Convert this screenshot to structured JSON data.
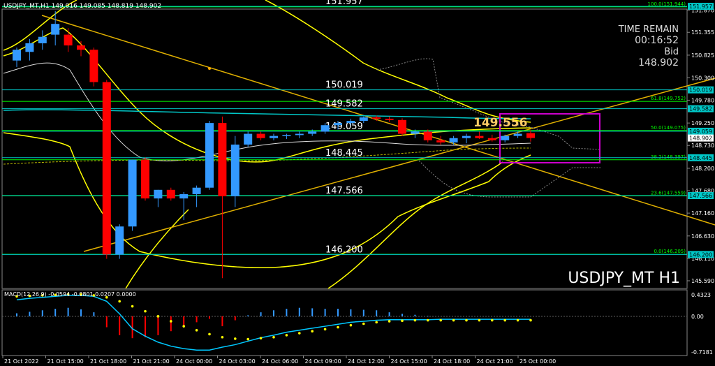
{
  "header": {
    "title": "USDJPY_MT,H1  149.016 149.085 148.819 148.902"
  },
  "info": {
    "time_remain_label": "TIME REMAIN",
    "time_remain": "00:16:52",
    "bid_label": "Bid",
    "bid": "148.902",
    "watermark": "USDJPY_MT H1",
    "current_price_label": "149.556"
  },
  "colors": {
    "background": "#000000",
    "bull": "#3399ff",
    "bear": "#ff0000",
    "fibo": "#00ff00",
    "hline": "#00c8c8",
    "band": "#ffff00",
    "rect": "#cc00cc",
    "macd_signal": "#00c8ff",
    "macd_dots": "#ffff00"
  },
  "chart_data": [
    {
      "type": "candlestick",
      "title": "USDJPY_MT,H1",
      "ylim": [
        145.59,
        151.78
      ],
      "y_ticks": [
        "151.870",
        "151.355",
        "150.825",
        "150.300",
        "149.780",
        "149.250",
        "148.730",
        "148.200",
        "147.680",
        "147.160",
        "146.630",
        "146.110",
        "145.590"
      ],
      "x_ticks": [
        "21 Oct 2022",
        "21 Oct 15:00",
        "21 Oct 18:00",
        "21 Oct 21:00",
        "24 Oct 00:00",
        "24 Oct 03:00",
        "24 Oct 06:00",
        "24 Oct 09:00",
        "24 Oct 12:00",
        "24 Oct 15:00",
        "24 Oct 18:00",
        "24 Oct 21:00",
        "25 Oct 00:00"
      ],
      "candles": [
        {
          "o": 150.7,
          "h": 151.0,
          "l": 150.55,
          "c": 150.95
        },
        {
          "o": 150.9,
          "h": 151.2,
          "l": 150.7,
          "c": 151.1
        },
        {
          "o": 151.1,
          "h": 151.4,
          "l": 150.95,
          "c": 151.25
        },
        {
          "o": 151.3,
          "h": 151.85,
          "l": 151.05,
          "c": 151.55
        },
        {
          "o": 151.3,
          "h": 151.45,
          "l": 150.9,
          "c": 151.05
        },
        {
          "o": 151.05,
          "h": 151.15,
          "l": 150.8,
          "c": 150.95
        },
        {
          "o": 150.95,
          "h": 151.0,
          "l": 150.1,
          "c": 150.2
        },
        {
          "o": 150.2,
          "h": 150.25,
          "l": 146.1,
          "c": 146.2
        },
        {
          "o": 146.2,
          "h": 146.9,
          "l": 146.1,
          "c": 146.85
        },
        {
          "o": 146.85,
          "h": 148.4,
          "l": 146.75,
          "c": 148.4
        },
        {
          "o": 148.4,
          "h": 148.45,
          "l": 147.45,
          "c": 147.5
        },
        {
          "o": 147.5,
          "h": 147.7,
          "l": 147.3,
          "c": 147.7
        },
        {
          "o": 147.7,
          "h": 147.75,
          "l": 147.45,
          "c": 147.5
        },
        {
          "o": 147.5,
          "h": 147.65,
          "l": 147.0,
          "c": 147.6
        },
        {
          "o": 147.6,
          "h": 147.8,
          "l": 147.3,
          "c": 147.75
        },
        {
          "o": 147.75,
          "h": 149.3,
          "l": 147.7,
          "c": 149.25
        },
        {
          "o": 149.25,
          "h": 149.4,
          "l": 145.65,
          "c": 147.55
        },
        {
          "o": 147.55,
          "h": 148.95,
          "l": 147.3,
          "c": 148.75
        },
        {
          "o": 148.75,
          "h": 149.05,
          "l": 148.7,
          "c": 149.0
        },
        {
          "o": 149.0,
          "h": 149.05,
          "l": 148.85,
          "c": 148.9
        },
        {
          "o": 148.9,
          "h": 149.0,
          "l": 148.85,
          "c": 148.95
        },
        {
          "o": 148.95,
          "h": 149.0,
          "l": 148.88,
          "c": 148.97
        },
        {
          "o": 148.97,
          "h": 149.05,
          "l": 148.9,
          "c": 149.0
        },
        {
          "o": 149.0,
          "h": 149.1,
          "l": 148.95,
          "c": 149.05
        },
        {
          "o": 149.05,
          "h": 149.25,
          "l": 149.0,
          "c": 149.2
        },
        {
          "o": 149.2,
          "h": 149.3,
          "l": 149.1,
          "c": 149.25
        },
        {
          "o": 149.25,
          "h": 149.35,
          "l": 149.2,
          "c": 149.3
        },
        {
          "o": 149.3,
          "h": 149.4,
          "l": 149.25,
          "c": 149.38
        },
        {
          "o": 149.38,
          "h": 149.42,
          "l": 149.3,
          "c": 149.35
        },
        {
          "o": 149.35,
          "h": 149.4,
          "l": 149.28,
          "c": 149.32
        },
        {
          "o": 149.32,
          "h": 149.36,
          "l": 148.95,
          "c": 149.0
        },
        {
          "o": 149.0,
          "h": 149.1,
          "l": 148.9,
          "c": 149.05
        },
        {
          "o": 149.05,
          "h": 149.1,
          "l": 148.8,
          "c": 148.85
        },
        {
          "o": 148.85,
          "h": 148.95,
          "l": 148.75,
          "c": 148.8
        },
        {
          "o": 148.8,
          "h": 148.95,
          "l": 148.75,
          "c": 148.9
        },
        {
          "o": 148.9,
          "h": 149.0,
          "l": 148.78,
          "c": 148.95
        },
        {
          "o": 148.95,
          "h": 149.05,
          "l": 148.88,
          "c": 148.9
        },
        {
          "o": 148.9,
          "h": 148.98,
          "l": 148.82,
          "c": 148.85
        },
        {
          "o": 148.85,
          "h": 148.98,
          "l": 148.8,
          "c": 148.95
        },
        {
          "o": 148.95,
          "h": 149.05,
          "l": 148.9,
          "c": 149.0
        },
        {
          "o": 149.016,
          "h": 149.085,
          "l": 148.819,
          "c": 148.902
        }
      ],
      "fibo_levels": [
        {
          "label": "100.0(151.944)",
          "price": 151.944
        },
        {
          "label": "61.8(149.752)",
          "price": 149.752
        },
        {
          "label": "50.0(149.075)",
          "price": 149.075
        },
        {
          "label": "38.2(148.397)",
          "price": 148.397
        },
        {
          "label": "23.6(147.559)",
          "price": 147.559
        },
        {
          "label": "0.0(146.205)",
          "price": 146.205
        }
      ],
      "level_labels": [
        {
          "label": "151.957",
          "price": 151.957
        },
        {
          "label": "150.019",
          "price": 150.019
        },
        {
          "label": "149.582",
          "price": 149.582
        },
        {
          "label": "149.059",
          "price": 149.059
        },
        {
          "label": "148.445",
          "price": 148.445
        },
        {
          "label": "147.566",
          "price": 147.566
        },
        {
          "label": "146.200",
          "price": 146.2
        }
      ],
      "price_tags": [
        {
          "label": "151.957",
          "price": 151.957
        },
        {
          "label": "150.019",
          "price": 150.019
        },
        {
          "label": "149.582",
          "price": 149.582
        },
        {
          "label": "149.059",
          "price": 149.059
        },
        {
          "label": "148.902",
          "price": 148.902
        },
        {
          "label": "148.445",
          "price": 148.445
        },
        {
          "label": "147.566",
          "price": 147.566
        },
        {
          "label": "146.200",
          "price": 146.2
        }
      ]
    },
    {
      "type": "bar",
      "title": "MACD(12,26,9) -0.0594 -0.0801 0.0207 0.0000",
      "ylim": [
        -0.7181,
        0.4323
      ],
      "y_ticks": [
        "0.4323",
        "0.00",
        "-0.7181"
      ],
      "histogram": [
        0.06,
        0.09,
        0.12,
        0.15,
        0.17,
        0.14,
        0.08,
        -0.22,
        -0.38,
        -0.44,
        -0.42,
        -0.38,
        -0.3,
        -0.2,
        -0.12,
        -0.05,
        -0.2,
        -0.08,
        0.02,
        0.08,
        0.12,
        0.15,
        0.17,
        0.16,
        0.15,
        0.15,
        0.14,
        0.13,
        0.12,
        0.08,
        0.05,
        0.03,
        0.01,
        0.0,
        0.0,
        0.0,
        0.0,
        0.0,
        0.0,
        0.0,
        0.0
      ],
      "signal": [
        0.33,
        0.36,
        0.38,
        0.4,
        0.42,
        0.42,
        0.4,
        0.3,
        0.05,
        -0.25,
        -0.4,
        -0.52,
        -0.6,
        -0.65,
        -0.68,
        -0.68,
        -0.62,
        -0.57,
        -0.5,
        -0.43,
        -0.38,
        -0.32,
        -0.28,
        -0.24,
        -0.2,
        -0.16,
        -0.12,
        -0.1,
        -0.08,
        -0.07,
        -0.07,
        -0.07,
        -0.07,
        -0.06,
        -0.06,
        -0.06,
        -0.06,
        -0.06,
        -0.06,
        -0.06,
        -0.06
      ],
      "dots": [
        0.4,
        0.41,
        0.42,
        0.43,
        0.44,
        0.44,
        0.42,
        0.38,
        0.3,
        0.2,
        0.1,
        0.0,
        -0.1,
        -0.2,
        -0.28,
        -0.36,
        -0.42,
        -0.45,
        -0.46,
        -0.44,
        -0.42,
        -0.38,
        -0.34,
        -0.3,
        -0.26,
        -0.22,
        -0.18,
        -0.15,
        -0.12,
        -0.1,
        -0.09,
        -0.08,
        -0.08,
        -0.08,
        -0.08,
        -0.08,
        -0.08,
        -0.08,
        -0.08,
        -0.08,
        -0.08
      ]
    }
  ]
}
